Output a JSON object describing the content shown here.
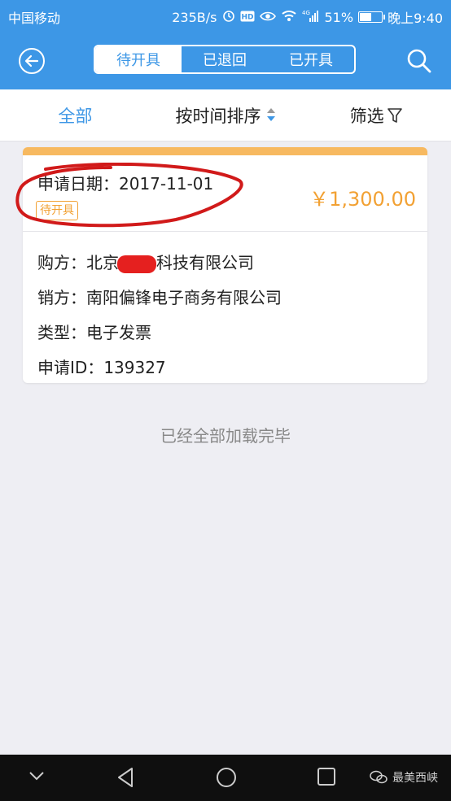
{
  "status_bar": {
    "carrier": "中国移动",
    "net_speed": "235B/s",
    "network": "4G",
    "battery_percent": "51%",
    "battery_level": 0.51,
    "time": "晚上9:40"
  },
  "header": {
    "tabs": [
      {
        "label": "待开具",
        "active": true
      },
      {
        "label": "已退回",
        "active": false
      },
      {
        "label": "已开具",
        "active": false
      }
    ],
    "back_icon": "back-arrow-icon",
    "search_icon": "search-icon"
  },
  "filter_bar": {
    "all_label": "全部",
    "sort_label": "按时间排序",
    "filter_label": "筛选"
  },
  "invoice": {
    "date_label": "申请日期：",
    "date_value": "2017-11-01",
    "status_badge": "待开具",
    "amount": "￥1,300.00",
    "buyer_label": "购方：",
    "buyer_prefix": "北京",
    "buyer_suffix": "科技有限公司",
    "seller_label": "销方：",
    "seller_value": "南阳偏锋电子商务有限公司",
    "type_label": "类型：",
    "type_value": "电子发票",
    "id_label": "申请ID：",
    "id_value": "139327"
  },
  "loaded_text": "已经全部加载完毕",
  "watermark": "最美西峡",
  "colors": {
    "primary": "#3d97e6",
    "accent": "#f2a133",
    "annotation": "#d11a1a"
  }
}
